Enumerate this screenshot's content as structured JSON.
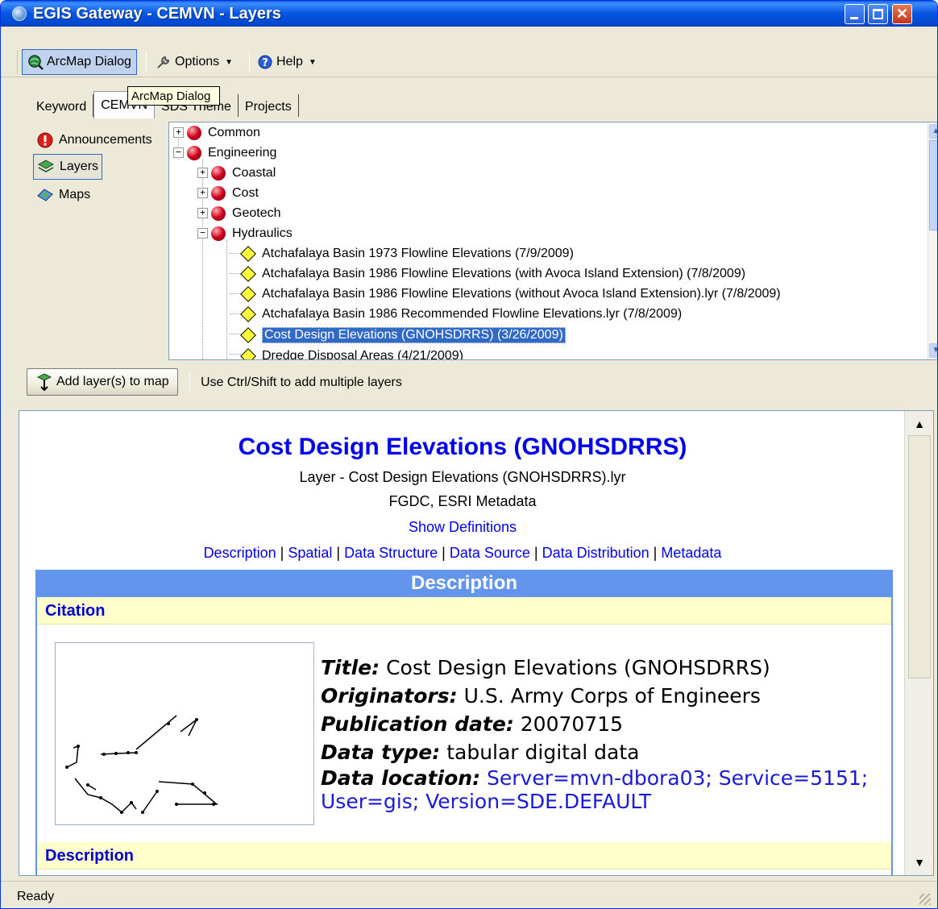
{
  "window": {
    "title": "EGIS Gateway - CEMVN - Layers"
  },
  "toolbar": {
    "arcmap_label": "ArcMap Dialog",
    "options_label": "Options",
    "help_label": "Help"
  },
  "tooltip": {
    "text": "ArcMap Dialog"
  },
  "tabs": {
    "keyword": "Keyword",
    "cemvn": "CEMVN",
    "sds": "SDS Theme",
    "projects": "Projects"
  },
  "side": {
    "announcements": "Announcements",
    "layers": "Layers",
    "maps": "Maps"
  },
  "tree": {
    "common": "Common",
    "engineering": "Engineering",
    "coastal": "Coastal",
    "cost": "Cost",
    "geotech": "Geotech",
    "hydraulics": "Hydraulics",
    "layers": [
      "Atchafalaya Basin 1973 Flowline Elevations (7/9/2009)",
      "Atchafalaya Basin 1986 Flowline Elevations (with Avoca Island Extension) (7/8/2009)",
      "Atchafalaya Basin 1986 Flowline Elevations (without Avoca Island Extension).lyr (7/8/2009)",
      "Atchafalaya Basin 1986 Recommended Flowline Elevations.lyr (7/8/2009)",
      "Cost Design Elevations (GNOHSDRRS) (3/26/2009)",
      "Dredge Disposal Areas (4/21/2009)"
    ]
  },
  "actions": {
    "add_layers": "Add layer(s) to map",
    "hint": "Use Ctrl/Shift to add multiple layers"
  },
  "doc": {
    "title": "Cost Design Elevations (GNOHSDRRS)",
    "layer_line": "Layer - Cost Design Elevations (GNOHSDRRS).lyr",
    "metadata_line": "FGDC, ESRI Metadata",
    "show_definitions": "Show Definitions",
    "links": [
      "Description",
      "Spatial",
      "Data Structure",
      "Data Source",
      "Data Distribution",
      "Metadata"
    ],
    "section_header": "Description",
    "citation_header": "Citation",
    "description_header": "Description",
    "fields": {
      "title_key": "Title:",
      "title_val": "Cost Design Elevations (GNOHSDRRS)",
      "originators_key": "Originators:",
      "originators_val": "U.S. Army Corps of Engineers",
      "pubdate_key": "Publication date:",
      "pubdate_val": "20070715",
      "datatype_key": "Data type:",
      "datatype_val": "tabular digital data",
      "location_key": "Data location:",
      "location_val_1": "Server=mvn-dbora03; Service=5151;",
      "location_val_2": "User=gis; Version=SDE.DEFAULT"
    }
  },
  "status": {
    "text": "Ready"
  }
}
